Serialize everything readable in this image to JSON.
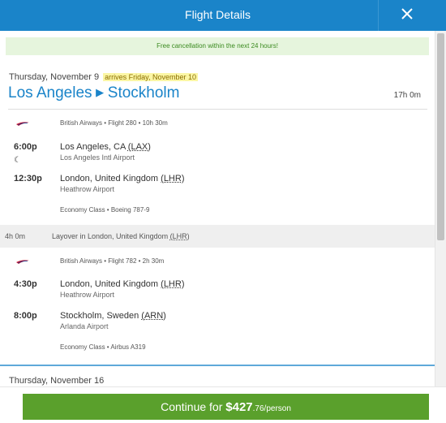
{
  "header": {
    "title": "Flight Details",
    "close_icon": "close-icon"
  },
  "banner": {
    "text": "Free cancellation within the next 24 hours!"
  },
  "outbound": {
    "date": "Thursday, November 9",
    "arrives": "arrives Friday, November 10",
    "origin": "Los Angeles",
    "destination": "Stockholm",
    "duration": "17h 0m",
    "segments": [
      {
        "airline_info": "British Airways • Flight 280 • 10h 30m",
        "depart_time": "6:00p",
        "depart_city": "Los Angeles, CA",
        "depart_code": "(LAX)",
        "depart_airport": "Los Angeles Intl Airport",
        "overnight_icon": "moon-icon",
        "arrive_time": "12:30p",
        "arrive_city": "London, United Kingdom",
        "arrive_code": "(LHR)",
        "arrive_airport": "Heathrow Airport",
        "cabin": "Economy Class • Boeing 787-9"
      },
      {
        "airline_info": "British Airways • Flight 782 • 2h 30m",
        "depart_time": "4:30p",
        "depart_city": "London, United Kingdom",
        "depart_code": "(LHR)",
        "depart_airport": "Heathrow Airport",
        "arrive_time": "8:00p",
        "arrive_city": "Stockholm, Sweden",
        "arrive_code": "(ARN)",
        "arrive_airport": "Arlanda Airport",
        "cabin": "Economy Class • Airbus A319"
      }
    ],
    "layover": {
      "duration": "4h 0m",
      "text": "Layover in London, United Kingdom",
      "code": "(LHR)"
    }
  },
  "return": {
    "date": "Thursday, November 16"
  },
  "footer": {
    "prefix": "Continue for ",
    "price_main": "$427",
    "price_cents": ".76/person"
  },
  "colors": {
    "brand": "#1a84c9",
    "continue": "#5aa02c",
    "banner_bg": "#e6f5dd",
    "airline_red": "#c8102e"
  }
}
